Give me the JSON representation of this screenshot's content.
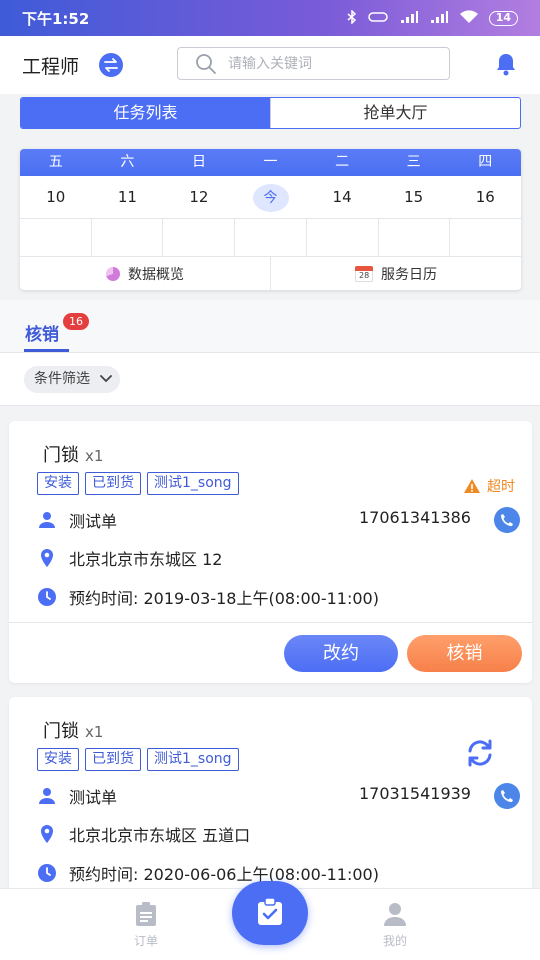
{
  "status_bar": {
    "time": "下午1:52",
    "battery": "14"
  },
  "header": {
    "role": "工程师",
    "search_placeholder": "请输入关键词"
  },
  "segment_tabs": [
    {
      "label": "任务列表",
      "active": true
    },
    {
      "label": "抢单大厅",
      "active": false
    }
  ],
  "calendar": {
    "weekdays": [
      "五",
      "六",
      "日",
      "一",
      "二",
      "三",
      "四"
    ],
    "days": [
      "10",
      "11",
      "12",
      "今",
      "14",
      "15",
      "16"
    ],
    "actions": [
      {
        "label": "数据概览",
        "icon": "pie-chart-icon"
      },
      {
        "label": "服务日历",
        "icon": "calendar-icon",
        "icon_text": "28"
      }
    ]
  },
  "subtab": {
    "label": "核销",
    "badge": "16"
  },
  "filter": {
    "label": "条件筛选"
  },
  "orders": [
    {
      "product": "门锁",
      "qty": "x1",
      "tags": [
        "安装",
        "已到货",
        "测试1_song"
      ],
      "status": "超时",
      "customer": "测试单",
      "phone": "17061341386",
      "address": "北京北京市东城区 12",
      "appointment": "预约时间: 2019-03-18上午(08:00-11:00)",
      "buttons": {
        "reschedule": "改约",
        "verify": "核销"
      }
    },
    {
      "product": "门锁",
      "qty": "x1",
      "tags": [
        "安装",
        "已到货",
        "测试1_song"
      ],
      "customer": "测试单",
      "phone": "17031541939",
      "address": "北京北京市东城区 五道口",
      "appointment": "预约时间: 2020-06-06上午(08:00-11:00)"
    }
  ],
  "bottom_nav": [
    {
      "label": "订单",
      "icon": "clipboard-icon"
    },
    {
      "label": "",
      "icon": "task-check-icon"
    },
    {
      "label": "我的",
      "icon": "user-icon"
    }
  ],
  "colors": {
    "primary": "#4c6ef5",
    "accent_orange": "#f7804a",
    "badge_red": "#e53e3e",
    "warning": "#f08a24"
  }
}
